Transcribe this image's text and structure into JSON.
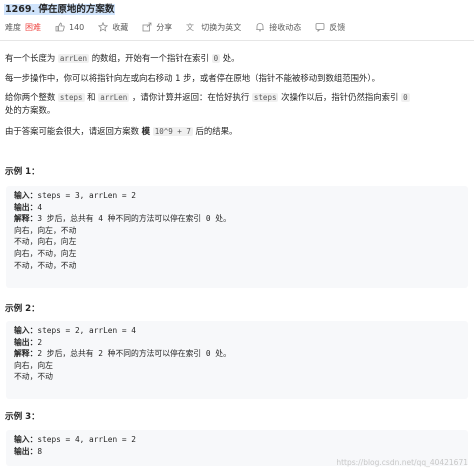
{
  "header": {
    "title": "1269. 停在原地的方案数"
  },
  "meta": {
    "difficulty_label": "难度",
    "difficulty_value": "困难",
    "likes": "140",
    "favorite": "收藏",
    "share": "分享",
    "switch_lang": "切换为英文",
    "notify": "接收动态",
    "feedback": "反馈"
  },
  "description": {
    "p1_a": "有一个长度为",
    "p1_code": "arrLen",
    "p1_b": "的数组，开始有一个指针在索引",
    "p1_code2": "0",
    "p1_c": "处。",
    "p2": "每一步操作中，你可以将指针向左或向右移动 1 步，或者停在原地（指针不能被移动到数组范围外）。",
    "p3_a": "给你两个整数",
    "p3_code1": "steps",
    "p3_b": "和",
    "p3_code2": "arrLen",
    "p3_c": "，请你计算并返回：在恰好执行",
    "p3_code3": "steps",
    "p3_d": "次操作以后，指针仍然指向索引",
    "p3_code4": "0",
    "p3_e": "处的方案数。",
    "p4_a": "由于答案可能会很大，请返回方案数",
    "p4_b": "模",
    "p4_code": "10^9 + 7",
    "p4_c": "后的结果。"
  },
  "examples": [
    {
      "title": "示例 1：",
      "input_label": "输入：",
      "input": "steps = 3, arrLen = 2",
      "output_label": "输出：",
      "output": "4",
      "explain_label": "解释：",
      "explain": "3 步后，总共有 4 种不同的方法可以停在索引 0 处。",
      "lines": [
        "向右，向左，不动",
        "不动，向右，向左",
        "向右，不动，向左",
        "不动，不动，不动"
      ]
    },
    {
      "title": "示例 2：",
      "input_label": "输入：",
      "input": "steps = 2, arrLen = 4",
      "output_label": "输出：",
      "output": "2",
      "explain_label": "解释：",
      "explain": "2 步后，总共有 2 种不同的方法可以停在索引 0 处。",
      "lines": [
        "向右，向左",
        "不动，不动"
      ]
    },
    {
      "title": "示例 3：",
      "input_label": "输入：",
      "input": "steps = 4, arrLen = 2",
      "output_label": "输出：",
      "output": "8"
    }
  ],
  "watermark": "https://blog.csdn.net/qq_40421671",
  "colors": {
    "difficulty": "#ef4743",
    "title_highlight": "#cfe3fb",
    "code_bg": "#f7f8fa"
  }
}
